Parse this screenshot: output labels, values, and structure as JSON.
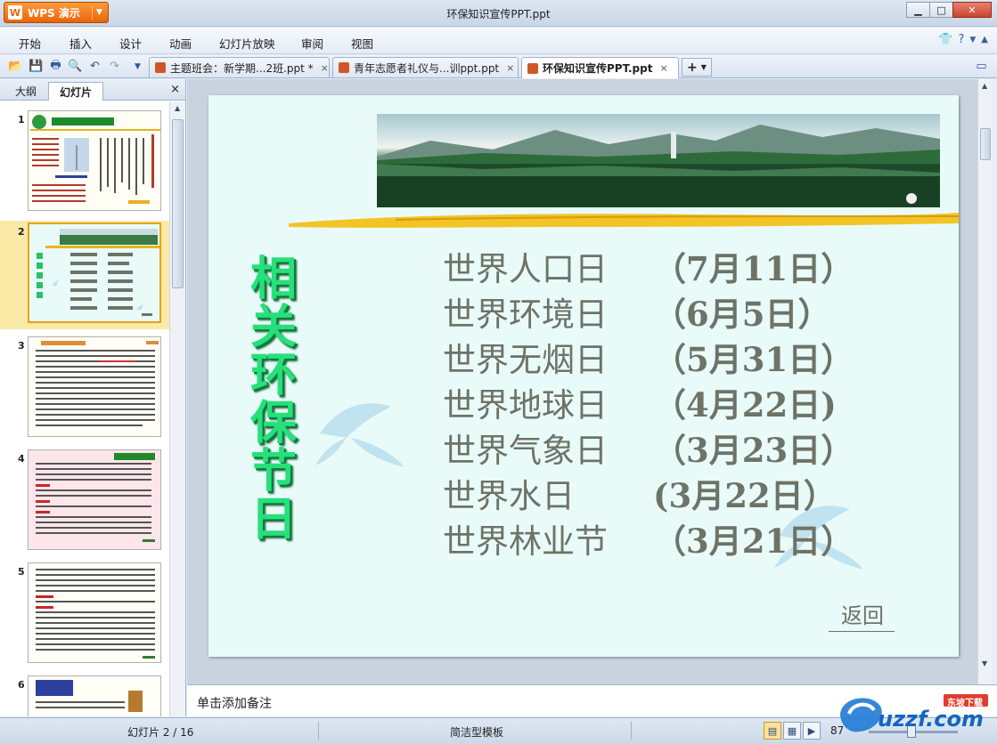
{
  "window": {
    "app_button": "WPS 演示",
    "title": "环保知识宣传PPT.ppt"
  },
  "menu": {
    "items": [
      "开始",
      "插入",
      "设计",
      "动画",
      "幻灯片放映",
      "审阅",
      "视图"
    ]
  },
  "tabs": [
    {
      "label": "主题班会：新学期...2班.ppt *",
      "close": "×"
    },
    {
      "label": "青年志愿者礼仪与...训ppt.ppt",
      "close": "×"
    },
    {
      "label": "环保知识宣传PPT.ppt",
      "close": "×"
    }
  ],
  "left_panel": {
    "tab_outline": "大纲",
    "tab_slides": "幻灯片",
    "close": "×",
    "slide_numbers": [
      "1",
      "2",
      "3",
      "4",
      "5",
      "6"
    ]
  },
  "slide": {
    "vertical_title": "相关环保节日",
    "festivals": [
      {
        "name": "世界人口日",
        "date": "（7月11日）"
      },
      {
        "name": "世界环境日",
        "date": "（6月5日）"
      },
      {
        "name": "世界无烟日",
        "date": "（5月31日）"
      },
      {
        "name": "世界地球日",
        "date": "（4月22日)"
      },
      {
        "name": "世界气象日",
        "date": "（3月23日）"
      },
      {
        "name": "世界水日",
        "date": "(3月22日）"
      },
      {
        "name": "世界林业节",
        "date": "（3月21日）"
      }
    ],
    "back_link": "返回"
  },
  "notes": {
    "placeholder": "单击添加备注"
  },
  "status": {
    "slide_indicator": "幻灯片 2 / 16",
    "template": "简洁型模板",
    "zoom": "87"
  },
  "watermark": {
    "text": "uzzf.com",
    "sub": "东坡下载"
  },
  "colors": {
    "accent_orange": "#e9650a",
    "title_green": "#27e07b",
    "festival_text": "#6e7367",
    "slide_bg": "#e9fbf9",
    "selected_thumb": "#fbe9a6"
  }
}
